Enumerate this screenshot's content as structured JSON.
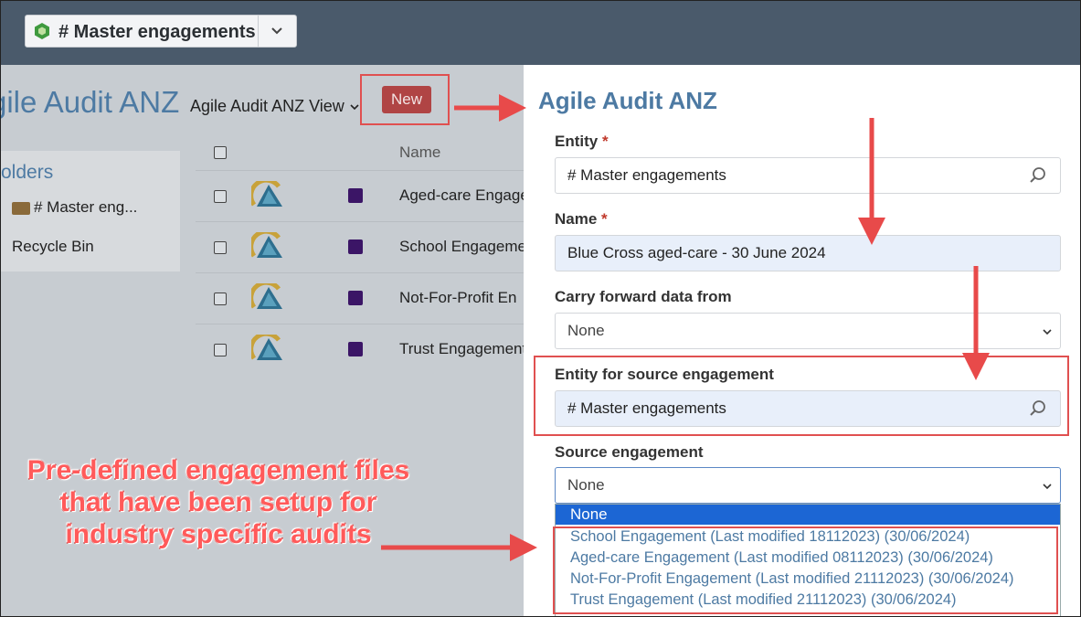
{
  "topbar": {
    "entity_label": "# Master engagements",
    "hex_icon": "hexagon-icon",
    "chevron_icon": "chevron-down-icon"
  },
  "page": {
    "title": "gile Audit ANZ",
    "view_label": "Agile Audit ANZ View",
    "new_button": "New",
    "folders_heading": "olders",
    "folder_item": "# Master eng...",
    "recycle_bin": "Recycle Bin",
    "list_header_name": "Name",
    "rows": [
      {
        "name": "Aged-care Engage"
      },
      {
        "name": "School Engageme"
      },
      {
        "name": "Not-For-Profit En"
      },
      {
        "name": "Trust Engagement"
      }
    ]
  },
  "panel": {
    "title": "Agile Audit ANZ",
    "entity_label": "Entity",
    "entity_value": "# Master engagements",
    "name_label": "Name",
    "name_value": "Blue Cross aged-care - 30 June 2024",
    "carry_label": "Carry forward data from",
    "carry_value": "None",
    "source_entity_label": "Entity for source engagement",
    "source_entity_value": "# Master engagements",
    "source_engagement_label": "Source engagement",
    "source_engagement_value": "None",
    "required_marker": "*",
    "dropdown_options": [
      "None",
      "School Engagement (Last modified 18112023) (30/06/2024)",
      "Aged-care Engagement (Last modified 08112023) (30/06/2024)",
      "Not-For-Profit Engagement (Last modified 21112023) (30/06/2024)",
      "Trust Engagement (Last modified 21112023) (30/06/2024)"
    ]
  },
  "callout": {
    "line1": "Pre-defined engagement files",
    "line2": "that have been setup for",
    "line3": "industry specific audits"
  },
  "colors": {
    "topbar": "#4a5a6b",
    "accent_blue": "#4d7aa3",
    "new_button": "#b04444",
    "annotation_red": "#e05050",
    "dropdown_selected": "#1c66d4"
  }
}
